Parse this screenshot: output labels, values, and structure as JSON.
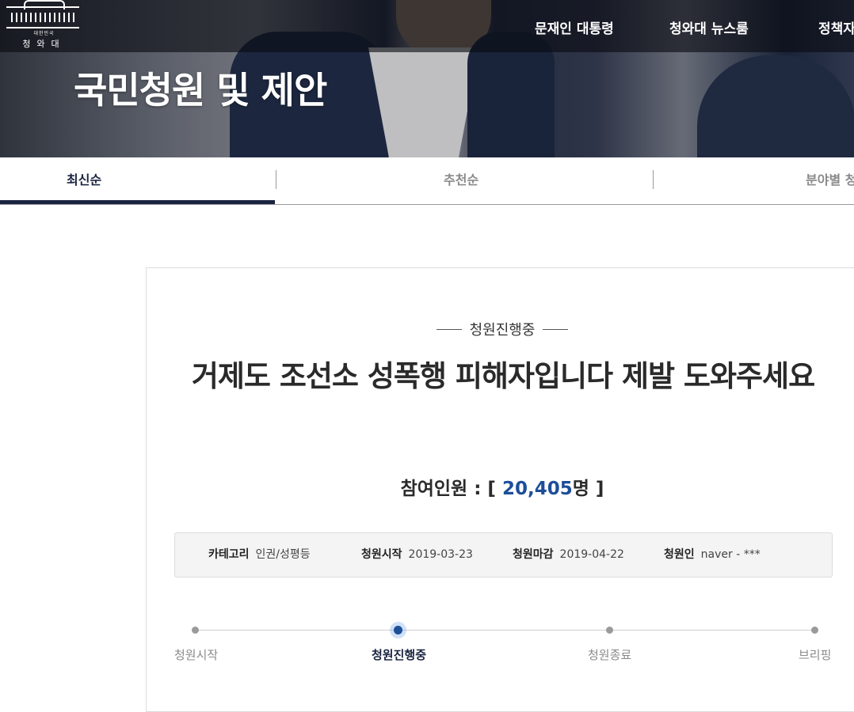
{
  "header": {
    "logo_sub": "대한민국",
    "logo_name": "청와대",
    "nav": [
      "문재인 대통령",
      "청와대 뉴스룸",
      "정책자"
    ],
    "page_title": "국민청원 및 제안"
  },
  "tabs": [
    {
      "label": "최신순",
      "active": true
    },
    {
      "label": "추천순",
      "active": false
    },
    {
      "label": "분야별 청",
      "active": false
    }
  ],
  "petition": {
    "status": "청원진행중",
    "title": "거제도 조선소 성폭행 피해자입니다 제발 도와주세요",
    "participants_label": "참여인원 : [",
    "participants_count": "20,405",
    "participants_unit": "명 ]",
    "info": [
      {
        "key": "카테고리",
        "value": "인권/성평등"
      },
      {
        "key": "청원시작",
        "value": "2019-03-23"
      },
      {
        "key": "청원마감",
        "value": "2019-04-22"
      },
      {
        "key": "청원인",
        "value": "naver - ***"
      }
    ]
  },
  "progress": {
    "steps": [
      "청원시작",
      "청원진행중",
      "청원종료",
      "브리핑"
    ],
    "current_index": 1
  },
  "colors": {
    "accent": "#1d4e9a",
    "tab_active": "#1a2440"
  }
}
